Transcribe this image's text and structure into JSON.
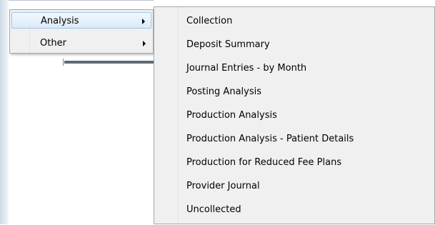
{
  "menu": {
    "items": [
      {
        "label": "Analysis",
        "has_submenu": true,
        "highlighted": true
      },
      {
        "label": "Other",
        "has_submenu": true,
        "highlighted": false
      }
    ]
  },
  "submenu": {
    "items": [
      "Collection",
      "Deposit Summary",
      "Journal Entries - by Month",
      "Posting Analysis",
      "Production Analysis",
      "Production Analysis - Patient Details",
      "Production for Reduced Fee Plans",
      "Provider Journal",
      "Uncollected"
    ]
  },
  "colors": {
    "menu_background": "#f0f0f0",
    "hover_fill": "#dbeaf8",
    "hover_border": "#9ec6ea",
    "menu_border": "#a8a8a8"
  },
  "icons": {
    "submenu_arrow": "right-triangle"
  }
}
